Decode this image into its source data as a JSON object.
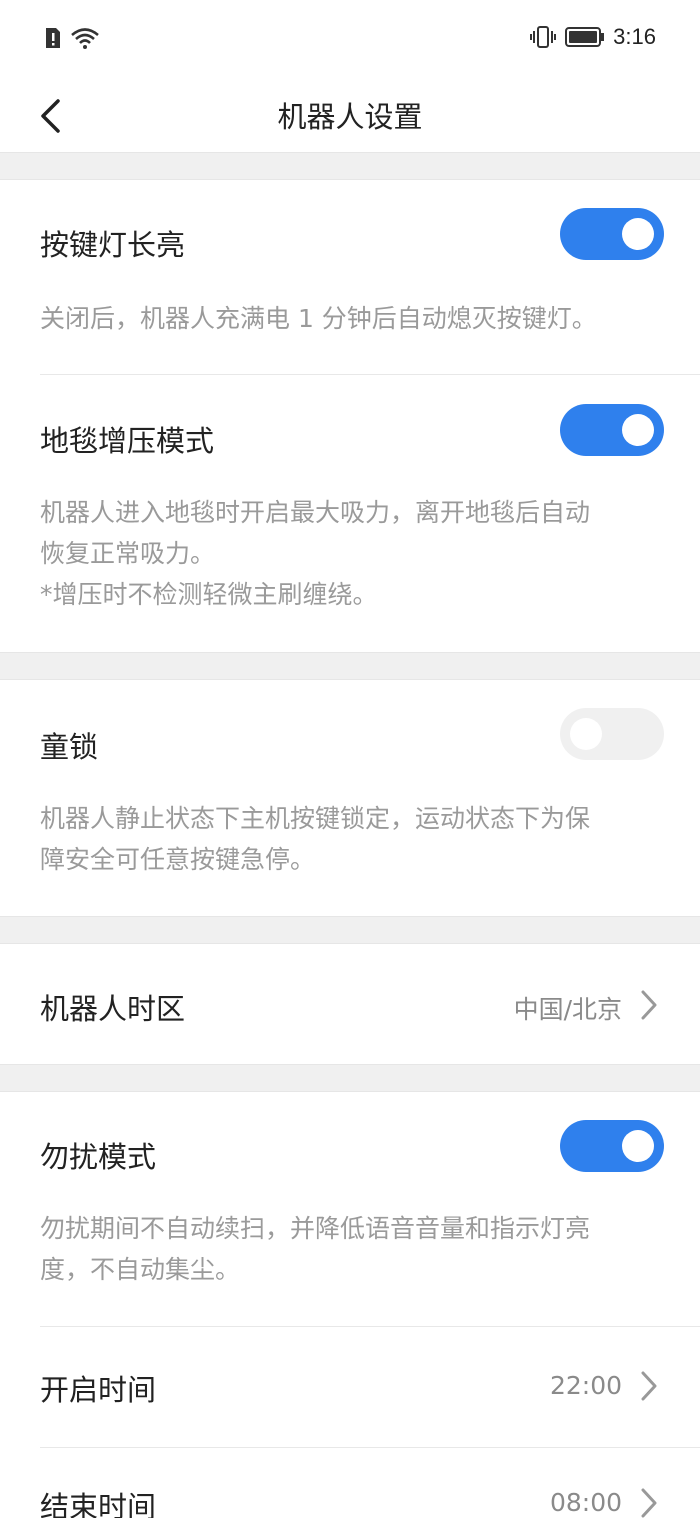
{
  "status_bar": {
    "time": "3:16"
  },
  "header": {
    "title": "机器人设置"
  },
  "settings": {
    "key_light": {
      "label": "按键灯长亮",
      "enabled": true,
      "description": "关闭后，机器人充满电 1 分钟后自动熄灭按键灯。"
    },
    "carpet_boost": {
      "label": "地毯增压模式",
      "enabled": true,
      "description_line1": "机器人进入地毯时开启最大吸力，离开地毯后自动",
      "description_line2": "恢复正常吸力。",
      "description_line3": "*增压时不检测轻微主刷缠绕。"
    },
    "child_lock": {
      "label": "童锁",
      "enabled": false,
      "description_line1": "机器人静止状态下主机按键锁定，运动状态下为保",
      "description_line2": "障安全可任意按键急停。"
    },
    "timezone": {
      "label": "机器人时区",
      "value": "中国/北京"
    },
    "dnd": {
      "label": "勿扰模式",
      "enabled": true,
      "description_line1": "勿扰期间不自动续扫，并降低语音音量和指示灯亮",
      "description_line2": "度，不自动集尘。"
    },
    "start_time": {
      "label": "开启时间",
      "value": "22:00"
    },
    "end_time": {
      "label": "结束时间",
      "value": "08:00"
    }
  },
  "colors": {
    "accent": "#2f80ed",
    "toggle_off": "#f0f0f0",
    "section_gap": "#f0f0f0"
  }
}
